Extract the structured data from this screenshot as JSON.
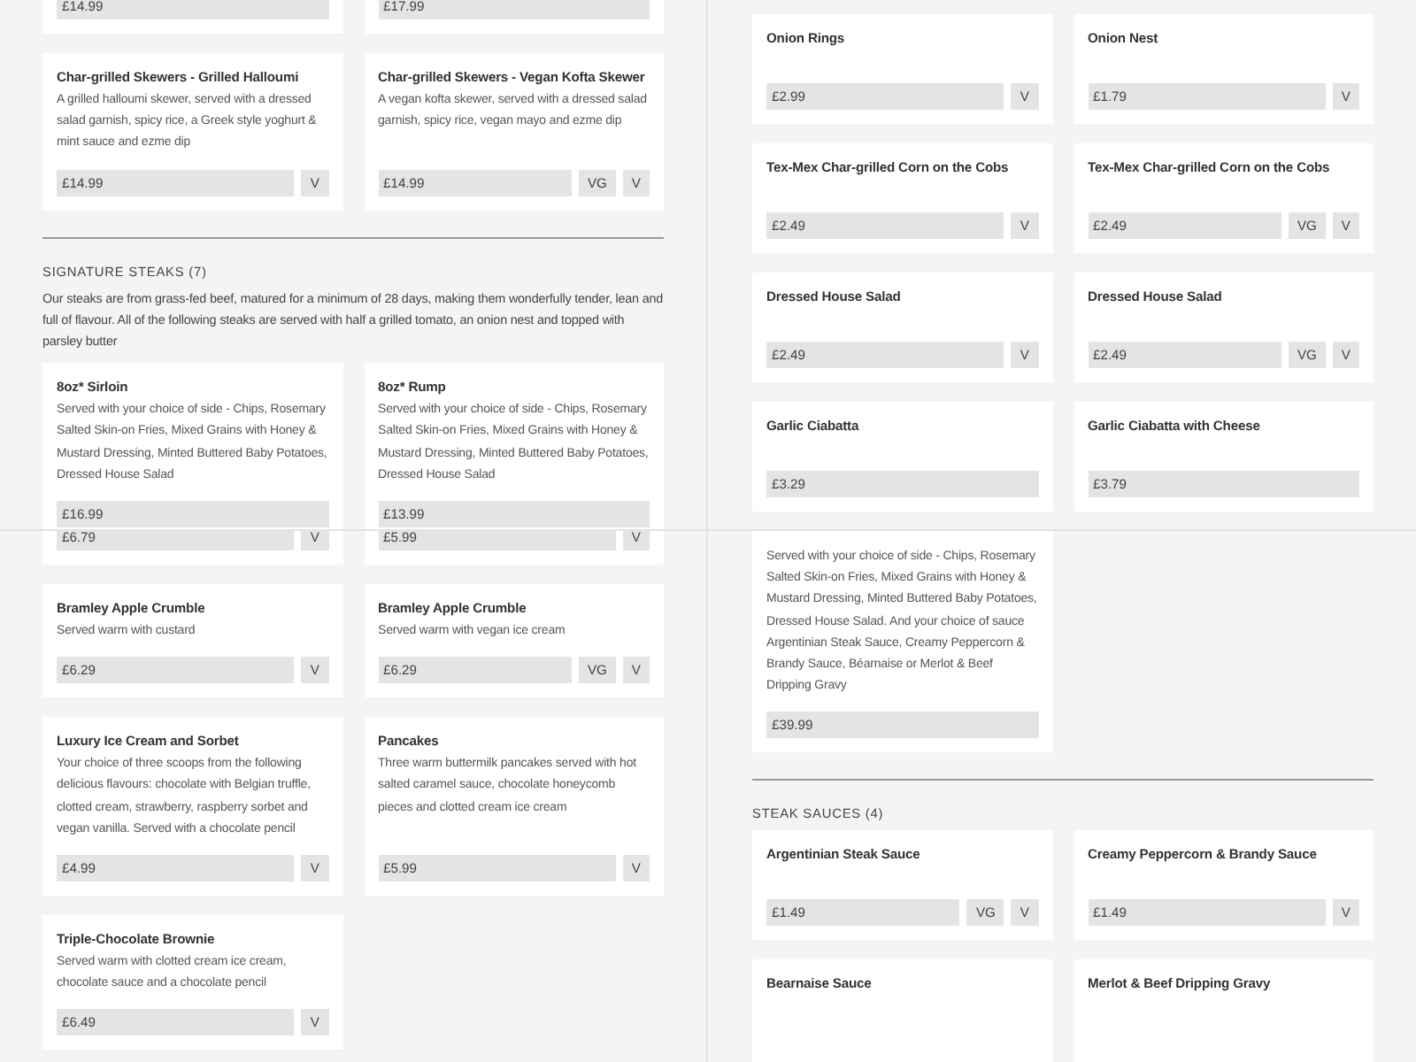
{
  "panels": [
    {
      "blocks": [
        {
          "kind": "cards",
          "cards": [
            {
              "price": "£14.99"
            },
            {
              "price": "£17.99"
            }
          ]
        },
        {
          "kind": "cards",
          "cards": [
            {
              "title": "Char-grilled Skewers - Grilled Halloumi",
              "description": "A grilled halloumi skewer, served with a dressed salad garnish, spicy rice, a Greek style yoghurt & mint sauce and ezme dip",
              "price": "£14.99",
              "tags": [
                "V"
              ]
            },
            {
              "title": "Char-grilled Skewers - Vegan Kofta Skewer",
              "description": "A vegan kofta skewer, served with a dressed salad garnish, spicy rice, vegan mayo and ezme dip",
              "price": "£14.99",
              "tags": [
                "VG",
                "V"
              ]
            }
          ]
        },
        {
          "kind": "divider"
        },
        {
          "kind": "heading",
          "text": "SIGNATURE STEAKS (7)"
        },
        {
          "kind": "intro",
          "text": "Our steaks are from grass-fed beef, matured for a minimum of 28 days, making them wonderfully tender, lean and full of flavour. All of the following steaks are served with half a grilled tomato, an onion nest and topped with parsley butter"
        },
        {
          "kind": "cards",
          "cards": [
            {
              "title": "8oz* Sirloin",
              "description": "Served with your choice of side - Chips, Rosemary Salted Skin-on Fries, Mixed Grains with Honey & Mustard Dressing, Minted Buttered Baby Potatoes, Dressed House Salad",
              "price": "£16.99"
            },
            {
              "title": "8oz* Rump",
              "description": "Served with your choice of side - Chips, Rosemary Salted Skin-on Fries, Mixed Grains with Honey & Mustard Dressing, Minted Buttered Baby Potatoes, Dressed House Salad",
              "price": "£13.99"
            }
          ]
        }
      ]
    },
    {
      "blocks": [
        {
          "kind": "cards",
          "cards": [
            {
              "title": "Onion Rings",
              "price": "£2.99",
              "tags": [
                "V"
              ]
            },
            {
              "title": "Onion Nest",
              "price": "£1.79",
              "tags": [
                "V"
              ]
            }
          ]
        },
        {
          "kind": "cards",
          "cards": [
            {
              "title": "Tex-Mex Char-grilled Corn on the Cobs",
              "price": "£2.49",
              "tags": [
                "V"
              ]
            },
            {
              "title": "Tex-Mex Char-grilled Corn on the Cobs",
              "price": "£2.49",
              "tags": [
                "VG",
                "V"
              ]
            }
          ]
        },
        {
          "kind": "cards",
          "cards": [
            {
              "title": "Dressed House Salad",
              "price": "£2.49",
              "tags": [
                "V"
              ]
            },
            {
              "title": "Dressed House Salad",
              "price": "£2.49",
              "tags": [
                "VG",
                "V"
              ]
            }
          ]
        },
        {
          "kind": "cards",
          "cards": [
            {
              "title": "Garlic Ciabatta",
              "price": "£3.29"
            },
            {
              "title": "Garlic Ciabatta with Cheese",
              "price": "£3.79"
            }
          ]
        }
      ]
    },
    {
      "blocks": [
        {
          "kind": "cards",
          "cards": [
            {
              "price": "£6.79",
              "tags": [
                "V"
              ]
            },
            {
              "price": "£5.99",
              "tags": [
                "V"
              ]
            }
          ]
        },
        {
          "kind": "cards",
          "cards": [
            {
              "title": "Bramley Apple Crumble",
              "description": "Served warm with custard",
              "price": "£6.29",
              "tags": [
                "V"
              ]
            },
            {
              "title": "Bramley Apple Crumble",
              "description": "Served warm with vegan ice cream",
              "price": "£6.29",
              "tags": [
                "VG",
                "V"
              ]
            }
          ]
        },
        {
          "kind": "cards",
          "cards": [
            {
              "title": "Luxury Ice Cream and Sorbet",
              "description": "Your choice of three scoops from the following delicious flavours: chocolate with Belgian truffle, clotted cream, strawberry, raspberry sorbet and vegan vanilla. Served with a chocolate pencil",
              "price": "£4.99",
              "tags": [
                "V"
              ]
            },
            {
              "title": "Pancakes",
              "description": "Three warm buttermilk pancakes served with hot salted caramel sauce, chocolate honeycomb pieces and clotted cream ice cream",
              "price": "£5.99",
              "tags": [
                "V"
              ]
            }
          ]
        },
        {
          "kind": "cards",
          "cards": [
            {
              "title": "Triple-Chocolate Brownie",
              "description": "Served warm with clotted cream ice cream, chocolate sauce and a chocolate pencil",
              "price": "£6.49",
              "tags": [
                "V"
              ]
            }
          ]
        }
      ]
    },
    {
      "blocks": [
        {
          "kind": "cards",
          "cards": [
            {
              "description": "Served with your choice of side - Chips, Rosemary Salted Skin-on Fries, Mixed Grains with Honey & Mustard Dressing, Minted Buttered Baby Potatoes, Dressed House Salad. And your choice of sauce Argentinian Steak Sauce, Creamy Peppercorn & Brandy Sauce, Béarnaise or Merlot & Beef Dripping Gravy",
              "price": "£39.99"
            }
          ]
        },
        {
          "kind": "divider"
        },
        {
          "kind": "heading",
          "text": "STEAK SAUCES (4)"
        },
        {
          "kind": "cards",
          "cards": [
            {
              "title": "Argentinian Steak Sauce",
              "price": "£1.49",
              "tags": [
                "VG",
                "V"
              ]
            },
            {
              "title": "Creamy Peppercorn & Brandy Sauce",
              "price": "£1.49",
              "tags": [
                "V"
              ]
            }
          ]
        },
        {
          "kind": "cards",
          "cards": [
            {
              "title": "Bearnaise Sauce"
            },
            {
              "title": "Merlot & Beef Dripping Gravy"
            }
          ]
        }
      ]
    }
  ]
}
